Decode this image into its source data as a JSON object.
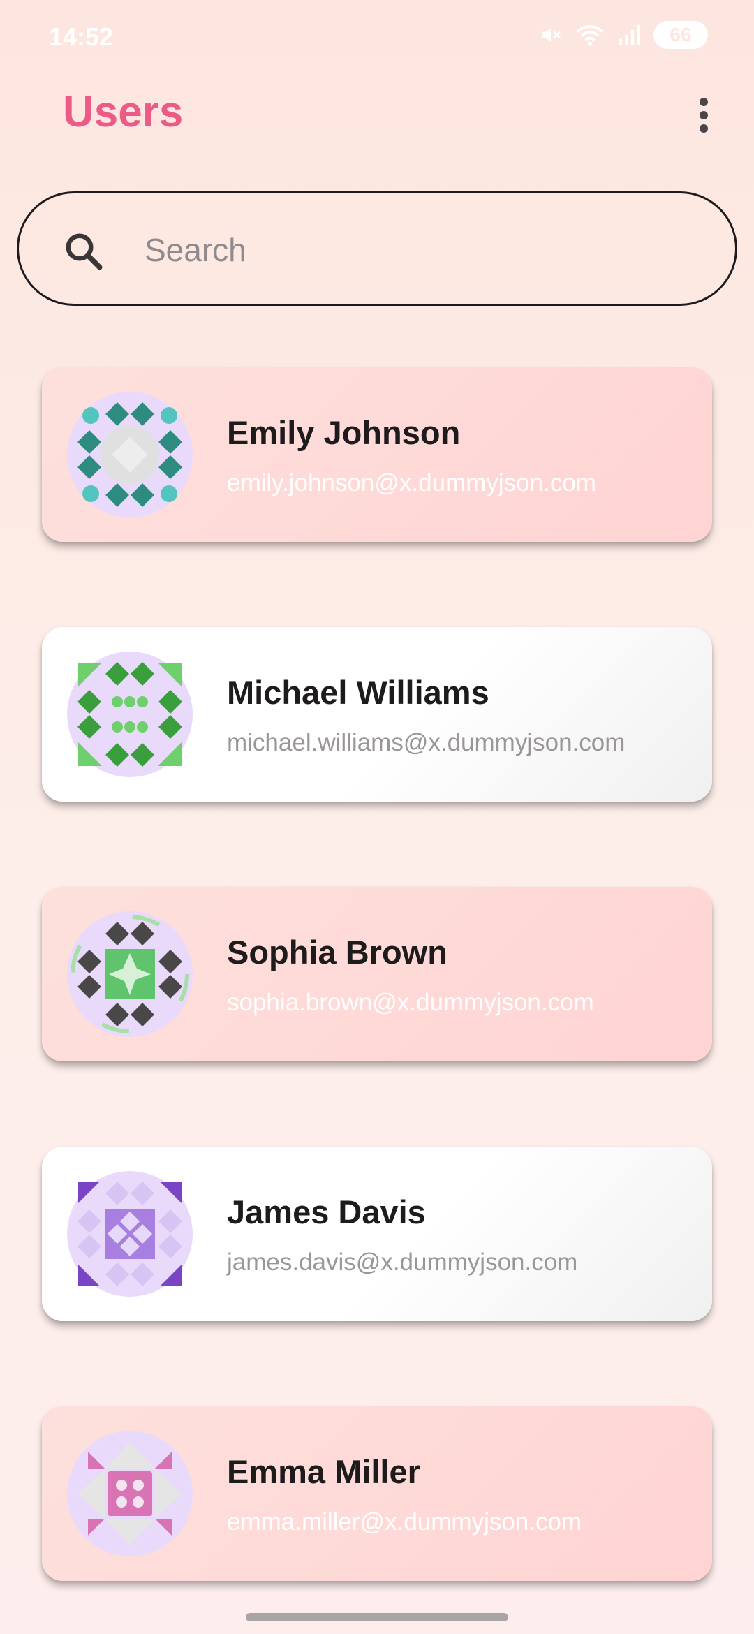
{
  "status_bar": {
    "time": "14:52",
    "battery": "66",
    "icons": [
      "mute-icon",
      "wifi-icon",
      "signal-icon",
      "battery-icon"
    ]
  },
  "app_bar": {
    "title": "Users",
    "menu_icon": "more-vert-icon",
    "title_color": "#ec5b88"
  },
  "search": {
    "placeholder": "Search",
    "value": "",
    "icon": "search-icon"
  },
  "users": [
    {
      "name": "Emily Johnson",
      "email": "emily.johnson@x.dummyjson.com",
      "card_style": "pink"
    },
    {
      "name": "Michael Williams",
      "email": "michael.williams@x.dummyjson.com",
      "card_style": "white"
    },
    {
      "name": "Sophia Brown",
      "email": "sophia.brown@x.dummyjson.com",
      "card_style": "pink"
    },
    {
      "name": "James Davis",
      "email": "james.davis@x.dummyjson.com",
      "card_style": "white"
    },
    {
      "name": "Emma Miller",
      "email": "emma.miller@x.dummyjson.com",
      "card_style": "pink"
    }
  ],
  "colors": {
    "accent": "#ec5b88",
    "pink_card": "#ffd4d3",
    "background": "#fde6df"
  }
}
